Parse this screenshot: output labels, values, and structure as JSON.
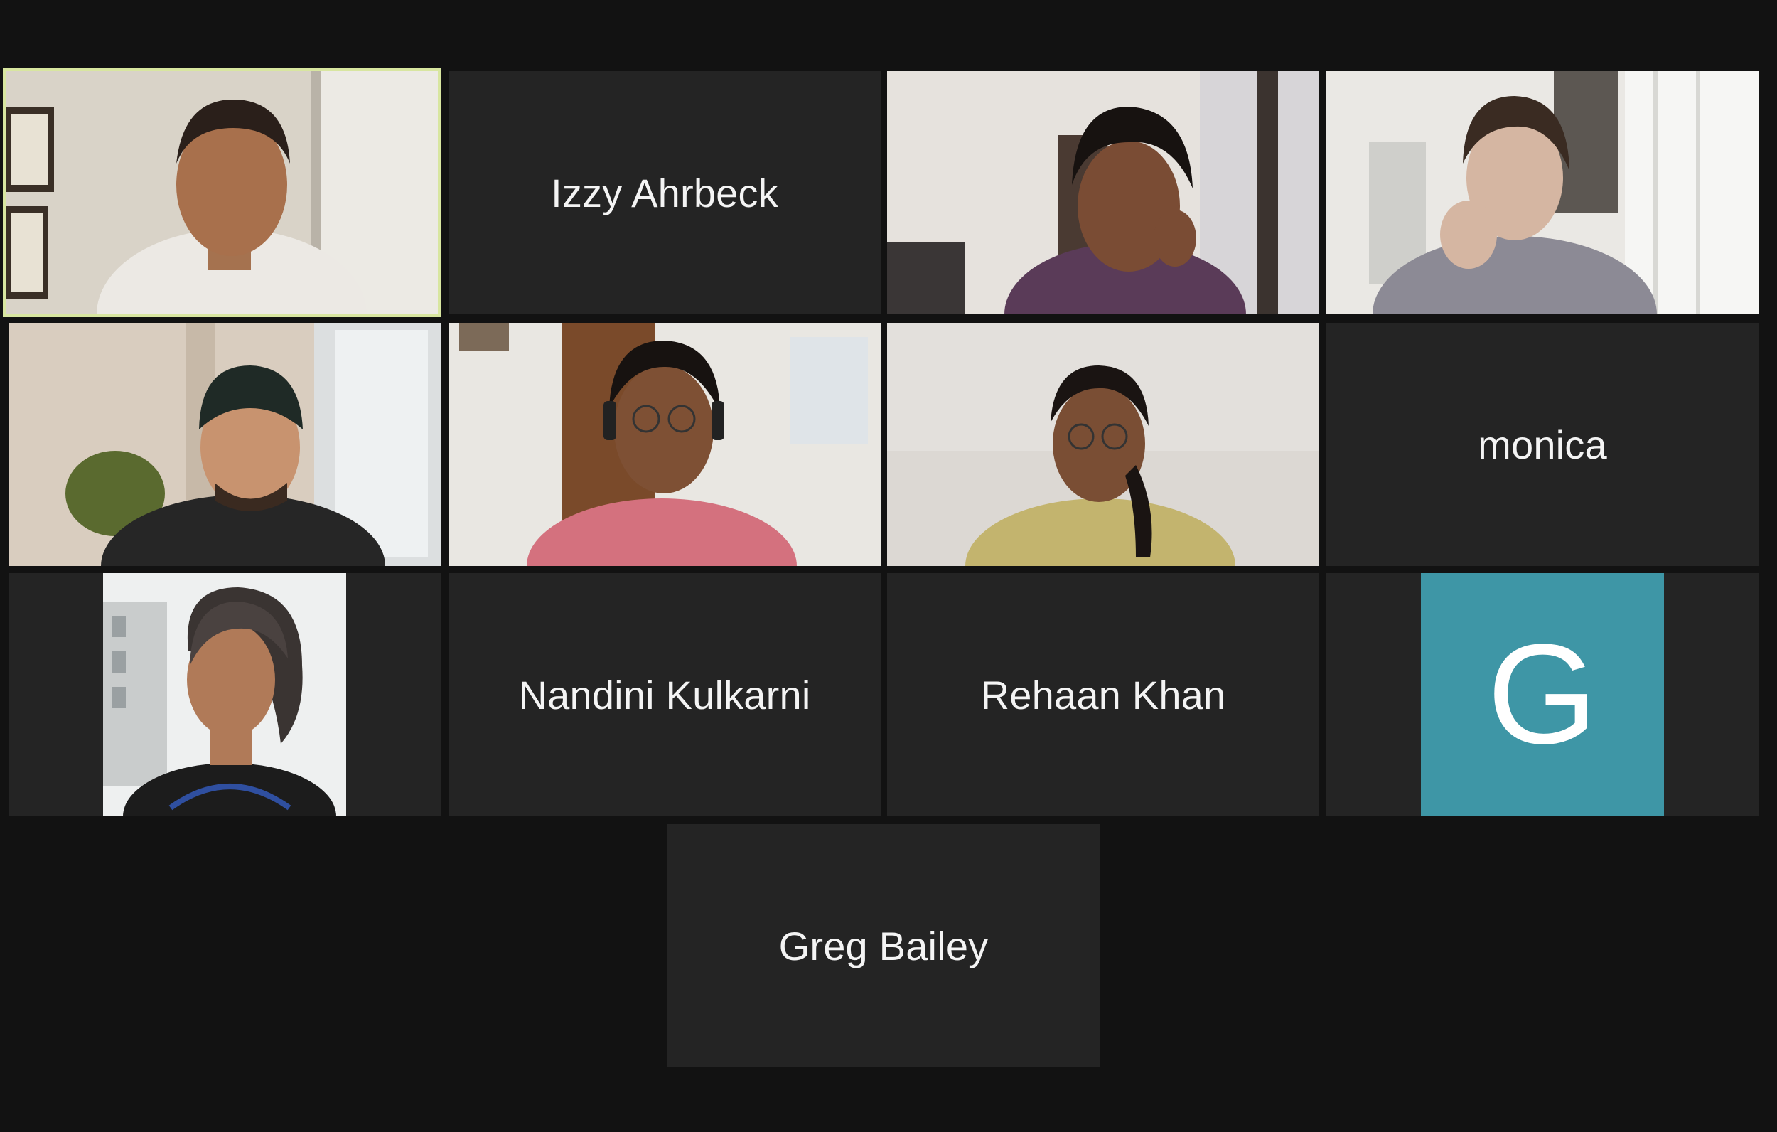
{
  "meeting": {
    "layout": "gallery",
    "active_speaker_color": "#d8e6a0",
    "avatar_color": "#3e96a6"
  },
  "participants": [
    {
      "kind": "video",
      "icon": "participant-video-man-white-shirt"
    },
    {
      "kind": "name",
      "name": "Izzy Ahrbeck"
    },
    {
      "kind": "video",
      "icon": "participant-video-woman-earphones"
    },
    {
      "kind": "video",
      "icon": "participant-video-woman-window"
    },
    {
      "kind": "video",
      "icon": "participant-video-man-beanie"
    },
    {
      "kind": "video",
      "icon": "participant-video-man-headphones"
    },
    {
      "kind": "video",
      "icon": "participant-video-woman-glasses"
    },
    {
      "kind": "name",
      "name": "monica"
    },
    {
      "kind": "photo",
      "icon": "participant-profile-photo"
    },
    {
      "kind": "name",
      "name": "Nandini Kulkarni"
    },
    {
      "kind": "name",
      "name": "Rehaan Khan"
    },
    {
      "kind": "avatar",
      "initial": "G"
    },
    {
      "kind": "name",
      "name": "Greg Bailey"
    }
  ]
}
